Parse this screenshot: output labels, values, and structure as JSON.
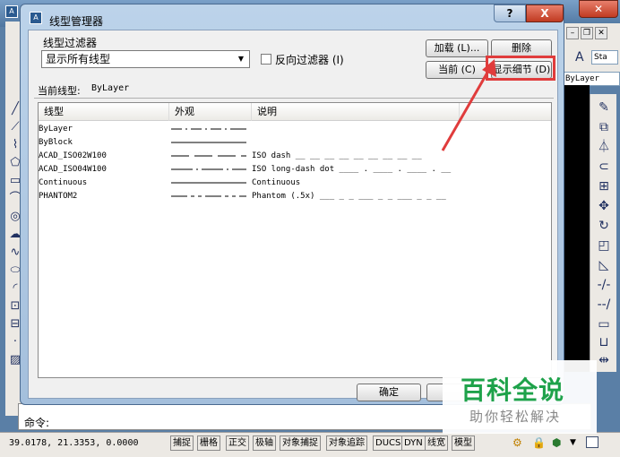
{
  "dialog": {
    "title": "线型管理器",
    "filter_label": "线型过滤器",
    "filter_value": "显示所有线型",
    "invert_label": "反向过滤器 (I)",
    "load_btn": "加载 (L)...",
    "delete_btn": "删除",
    "current_btn": "当前 (C)",
    "detail_btn": "显示细节 (D)",
    "current_linetype_label": "当前线型:",
    "current_linetype_value": "ByLayer",
    "columns": [
      "线型",
      "外观",
      "说明"
    ],
    "rows": [
      {
        "name": "ByLayer",
        "desc": ""
      },
      {
        "name": "ByBlock",
        "desc": ""
      },
      {
        "name": "ACAD_ISO02W100",
        "desc": "ISO dash __ __ __ __ __ __ __ __ __"
      },
      {
        "name": "ACAD_ISO04W100",
        "desc": "ISO long-dash dot ____ . ____ . ____ . __"
      },
      {
        "name": "Continuous",
        "desc": "Continuous"
      },
      {
        "name": "PHANTOM2",
        "desc": "Phantom (.5x) ___ _ _ ___ _ _ ___ _ _ __"
      }
    ],
    "ok_btn": "确定",
    "help_glyph": "?",
    "close_glyph": "X"
  },
  "right": {
    "layer_value": "ByLayer",
    "text_style": "Sta"
  },
  "command": {
    "prompt": "命令:"
  },
  "status": {
    "coords": "39.0178, 21.3353, 0.0000",
    "buttons": [
      "捕捉",
      "栅格",
      "正交",
      "极轴",
      "对象捕捉",
      "对象追踪",
      "DUCS",
      "DYN",
      "线宽",
      "模型"
    ]
  },
  "watermark": {
    "title": "百科全说",
    "subtitle": "助你轻松解决"
  },
  "colors": {
    "highlight": "#e03c3c",
    "watermark_green": "#1ea24a"
  }
}
